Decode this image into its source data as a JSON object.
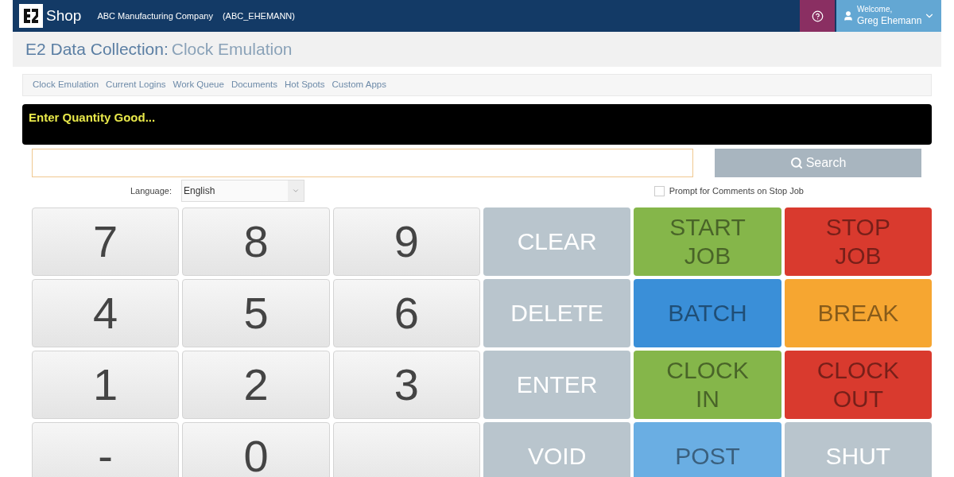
{
  "header": {
    "app_name": "Shop",
    "company": "ABC Manufacturing Company",
    "user_code": "(ABC_EHEMANN)",
    "welcome": "Welcome,",
    "user_name": "Greg Ehemann"
  },
  "page_title": {
    "prefix": "E2 Data Collection:",
    "name": "Clock Emulation"
  },
  "nav": [
    {
      "label": "Clock Emulation"
    },
    {
      "label": "Current Logins"
    },
    {
      "label": "Work Queue"
    },
    {
      "label": "Documents"
    },
    {
      "label": "Hot Spots"
    },
    {
      "label": "Custom Apps"
    }
  ],
  "prompt": "Enter Quantity Good...",
  "search_button": "Search",
  "language": {
    "label": "Language:",
    "value": "English"
  },
  "comments_checkbox": {
    "label": "Prompt for Comments on Stop Job",
    "checked": false
  },
  "keys": [
    {
      "kind": "digit",
      "lines": [
        "7"
      ]
    },
    {
      "kind": "digit",
      "lines": [
        "8"
      ]
    },
    {
      "kind": "digit",
      "lines": [
        "9"
      ]
    },
    {
      "kind": "command",
      "lines": [
        "CLEAR"
      ]
    },
    {
      "kind": "function",
      "color": "#85b64a",
      "lines": [
        "START",
        "JOB"
      ]
    },
    {
      "kind": "function",
      "color": "#d93a2e",
      "lines": [
        "STOP",
        "JOB"
      ]
    },
    {
      "kind": "digit",
      "lines": [
        "4"
      ]
    },
    {
      "kind": "digit",
      "lines": [
        "5"
      ]
    },
    {
      "kind": "digit",
      "lines": [
        "6"
      ]
    },
    {
      "kind": "command",
      "lines": [
        "DELETE"
      ]
    },
    {
      "kind": "function",
      "color": "#3a8fd8",
      "lines": [
        "BATCH"
      ]
    },
    {
      "kind": "function",
      "color": "#f6a631",
      "lines": [
        "BREAK"
      ]
    },
    {
      "kind": "digit",
      "lines": [
        "1"
      ]
    },
    {
      "kind": "digit",
      "lines": [
        "2"
      ]
    },
    {
      "kind": "digit",
      "lines": [
        "3"
      ]
    },
    {
      "kind": "command",
      "lines": [
        "ENTER"
      ]
    },
    {
      "kind": "function",
      "color": "#85b64a",
      "lines": [
        "CLOCK",
        "IN"
      ]
    },
    {
      "kind": "function",
      "color": "#d93a2e",
      "lines": [
        "CLOCK",
        "OUT"
      ]
    },
    {
      "kind": "digit",
      "lines": [
        "-"
      ]
    },
    {
      "kind": "digit",
      "lines": [
        "0"
      ]
    },
    {
      "kind": "blank"
    },
    {
      "kind": "command",
      "lines": [
        "VOID"
      ]
    },
    {
      "kind": "function",
      "color": "#6aaee3",
      "lines": [
        "POST"
      ]
    },
    {
      "kind": "command",
      "lines": [
        "SHUT"
      ]
    }
  ]
}
